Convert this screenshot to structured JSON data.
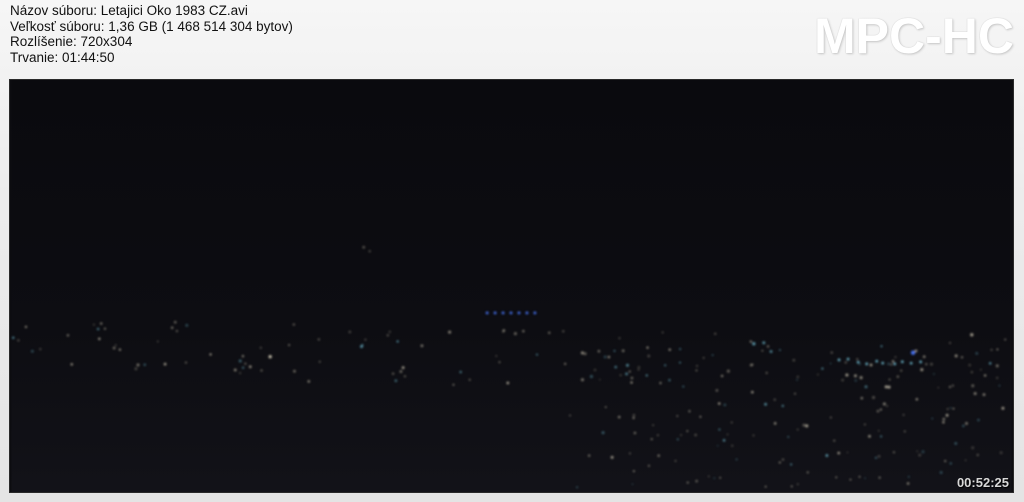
{
  "info": {
    "filename": "Názov súboru: Letajici Oko 1983 CZ.avi",
    "filesize": "Veľkosť súboru: 1,36 GB (1 468 514 304 bytov)",
    "resolution": "Rozlíšenie: 720x304",
    "duration": "Trvanie: 01:44:50"
  },
  "brand": "MPC-HC",
  "video": {
    "timestamp": "00:52:25",
    "scene": "night-city-lights",
    "colors": {
      "sky": "#0c0c10",
      "light_warm": "#e8e0c8",
      "light_blue": "#4a78ff",
      "light_cyan": "#7fd8f0"
    }
  }
}
